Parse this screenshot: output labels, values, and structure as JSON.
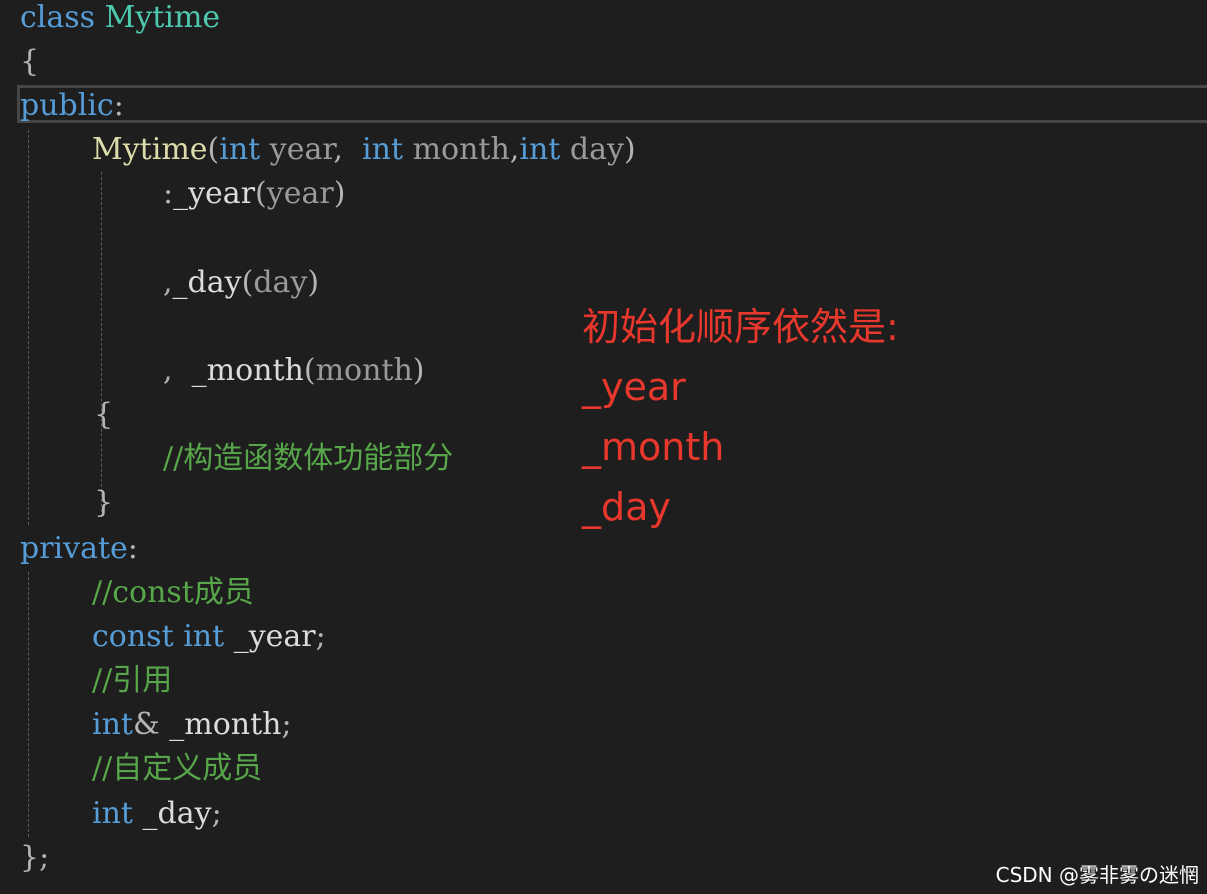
{
  "code": {
    "line1": {
      "kw": "class",
      "name": "Mytime"
    },
    "line2": {
      "brace": "{"
    },
    "line3": {
      "kw": "public",
      "colon": ":"
    },
    "line4": {
      "ctor": "Mytime",
      "open": "(",
      "t1": "int",
      "p1": "year",
      "sep1": ",",
      "t2": "int",
      "p2": "month",
      "sep2": ",",
      "t3": "int",
      "p3": "day",
      "close": ")"
    },
    "line5": {
      "colon": ":",
      "member": "_year",
      "open": "(",
      "arg": "year",
      "close": ")"
    },
    "line6": {
      "comma": ",",
      "member": "_day",
      "open": "(",
      "arg": "day",
      "close": ")"
    },
    "line7": {
      "comma": ",",
      "member": "_month",
      "open": "(",
      "arg": "month",
      "close": ")"
    },
    "line8": {
      "brace": "{"
    },
    "line9": {
      "comment": "//构造函数体功能部分"
    },
    "line10": {
      "brace": "}"
    },
    "line11": {
      "kw": "private",
      "colon": ":"
    },
    "line12": {
      "comment": "//const成员"
    },
    "line13": {
      "kw1": "const",
      "kw2": "int",
      "member": "_year",
      "semi": ";"
    },
    "line14": {
      "comment": "//引用"
    },
    "line15": {
      "kw": "int",
      "amp": "&",
      "member": "_month",
      "semi": ";"
    },
    "line16": {
      "comment": "//自定义成员"
    },
    "line17": {
      "kw": "int",
      "member": "_day",
      "semi": ";"
    },
    "line18": {
      "text": "};"
    }
  },
  "annotation": {
    "title": "初始化顺序依然是:",
    "items": [
      "_year",
      "_month",
      "_day"
    ]
  },
  "watermark": "CSDN @雾非雾の迷惘",
  "colors": {
    "background": "#1e1e1e",
    "keyword": "#569cd6",
    "class_name": "#4ec9b0",
    "function": "#dcdcaa",
    "comment": "#57a64a",
    "annotation": "#e8372c"
  }
}
